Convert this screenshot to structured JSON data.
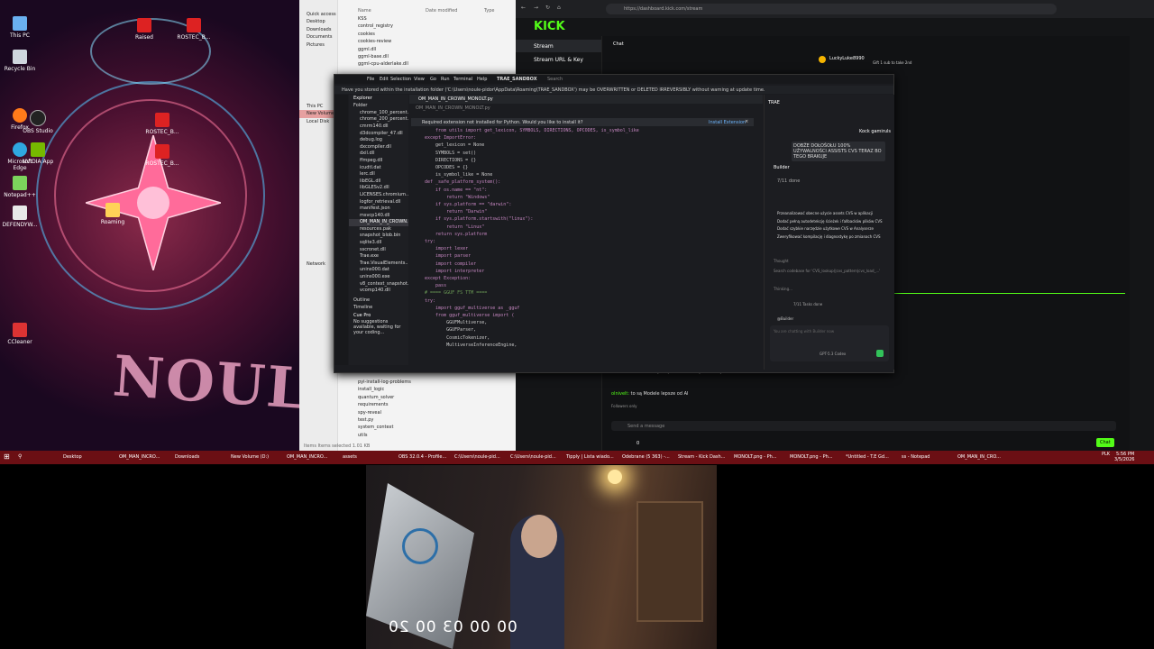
{
  "desktop": {
    "icons": [
      "This PC",
      "Recycle Bin",
      "Microsoft Edge",
      "Notepad++",
      "DEFENDYW...",
      "Firefox",
      "Microsoft Edge",
      "CCleaner",
      "OBS Studio",
      "NVIDIA App",
      "Roaming",
      "Raised",
      "ROSTEC_B...",
      "ROSTEC_B..."
    ],
    "wallpaper_text": "NOULA PID"
  },
  "explorer": {
    "sidebar": [
      "Quick access",
      "Desktop",
      "Downloads",
      "Documents",
      "Pictures",
      "This PC",
      "New Volume",
      "Local Disk",
      "Network"
    ],
    "columns": [
      "Name",
      "Date modified",
      "Type"
    ],
    "files_top": [
      "KSS",
      "control_registry",
      "cookies",
      "cookies-review",
      "ggml.dll",
      "ggml-base.dll",
      "ggml-cpu-alderlake.dll"
    ],
    "files_bottom": [
      "pyi-install-log-problems",
      "install_logic",
      "quantum_solver",
      "requirements",
      "spy-reveal",
      "test.py",
      "system_context",
      "utils"
    ],
    "status": "Items  Items selected  1.01 KB"
  },
  "browser": {
    "url": "https://dashboard.kick.com/stream",
    "logo": "KICK",
    "nav": [
      "Stream",
      "Stream URL & Key"
    ],
    "chat_title": "Chat",
    "chat_user": "LuckyLuke8990",
    "chat_gift": "Gift 1 sub to take 2nd",
    "messages": [
      {
        "user": "skamillovven:",
        "text": " to ni tylko prawda historyczna moja xddd"
      },
      {
        "user": "olnivelt:",
        "text": " to są Modele lepsze od AI"
      }
    ],
    "followers": "Followers only",
    "send_placeholder": "Send a message",
    "chat_button": "Chat",
    "points": "0"
  },
  "ide": {
    "menu": [
      "File",
      "Edit",
      "Selection",
      "View",
      "Go",
      "Run",
      "Terminal",
      "Help"
    ],
    "app": "TRAE_SANDBOX",
    "search": "Search",
    "warning": "Have you stored within the installation folder ('C:\\Users\\noule-pidor\\AppData\\Roaming\\TRAE_SANDBOX') may be OVERWRITTEN or DELETED IRREVERSIBLY without warning at update time.",
    "tab": "OM_MAN_IN_CROWN_MONOLT.py",
    "breadcrumb": "OM_MAN_IN_CROWN_MONOLT.py",
    "notice": "Required extension not installed for Python. Would you like to install it?",
    "install": "Install Extension",
    "explorer_title": "Explorer",
    "folder": "Folder",
    "files": [
      "chrome_100_percent...",
      "chrome_200_percent...",
      "cmrm140.dll",
      "d3dcompiler_47.dll",
      "debug.log",
      "dxcompiler.dll",
      "dxil.dll",
      "ffmpeg.dll",
      "icudtl.dat",
      "lerc.dll",
      "libEGL.dll",
      "libGLESv2.dll",
      "LICENSES.chromium...",
      "logfor_retrieval.dll",
      "manifest.json",
      "msvcp140.dll",
      "OM_MAN_IN_CROWN...",
      "resources.pak",
      "snapshot_blob.bin",
      "sqlite3.dll",
      "sscronet.dll",
      "Trae.exe",
      "Trae.VisualElements...",
      "unins000.dat",
      "unins000.exe",
      "v8_context_snapshot...",
      "vcomp140.dll"
    ],
    "outline": [
      "Outline",
      "Timeline"
    ],
    "cue": "Cue Pro",
    "cue_text": "No suggestions available, waiting for your coding...",
    "code": [
      "    from utils import get_lexicon, SYMBOLS, DIRECTIONS, OPCODES, is_symbol_like",
      "except ImportError:",
      "    get_lexicon = None",
      "    SYMBOLS = set()",
      "    DIRECTIONS = {}",
      "    OPCODES = {}",
      "    is_symbol_like = None",
      "",
      "def _safe_platform_system():",
      "    if os.name == \"nt\":",
      "        return \"Windows\"",
      "    if sys.platform == \"darwin\":",
      "        return \"Darwin\"",
      "    if sys.platform.startswith(\"linux\"):",
      "        return \"Linux\"",
      "    return sys.platform",
      "",
      "try:",
      "    import lexer",
      "    import parser",
      "    import compiler",
      "    import interpreter",
      "except Exception:",
      "    pass",
      "",
      "# ==== GGUF FS TTM ====",
      "try:",
      "    import gguf_multiverse as _gguf",
      "    from gguf_multiverse import (",
      "        GGUFMultiverse,",
      "        GGUFParser,",
      "        CosmicTokenizer,",
      "        MultiverseInferenceEngine,"
    ],
    "panel_title": "TRAE",
    "panel_user": "Kock gamiruls",
    "panel_msg": "DOBŻE DOŁOŚOŁU 100% UŻYWALNOŚCI ASSISTS CVS TERAZ BO TEGO BRAKUJE",
    "builder": "Builder",
    "todos_count": "7/11 done",
    "todos": [
      "Przeanalizować obecne użycie assets CVS w aplikacji",
      "Dodać pełną autodetekcję ścieżek i fallbacków plików CVS",
      "Dodać szybkie narzędzie użytkowe CVS w Analyserze",
      "Zweryfikować kompilację i diagnostykę po zmianach CVS"
    ],
    "thought": "Thought",
    "search_line": "Search codebase for 'CVS_lookup(|cvs_pattern|cvs_load_...'",
    "thinking": "Thinking...",
    "tasks_done": "7/11 Tasks done",
    "builder_tag": "@Builder",
    "input_placeholder": "You are chatting with Builder now",
    "model": "GPT-5.3 Codex"
  },
  "taskbar": {
    "items": [
      "Desktop",
      "OM_MAN_INCRO...",
      "Downloads",
      "New Volume (D:)",
      "OM_MAN_INCRO...",
      "assets",
      "OBS 32.0.4 - Profile...",
      "C:\\Users\\noule-pid...",
      "C:\\Users\\noule-pid...",
      "Tipply | Lista wiado...",
      "Odebrane (5 363) -...",
      "Stream - Kick Dash...",
      "MONOLT.png - Ph...",
      "MONOLT.png - Ph...",
      "*Untitled - T.E Gd...",
      "ss - Notepad",
      "OM_MAN_IN_CRO..."
    ],
    "lang": "PLK",
    "time": "5:56 PM",
    "date": "3/5/2026"
  },
  "webcam": {
    "timer": "00 00 03 00 20"
  }
}
